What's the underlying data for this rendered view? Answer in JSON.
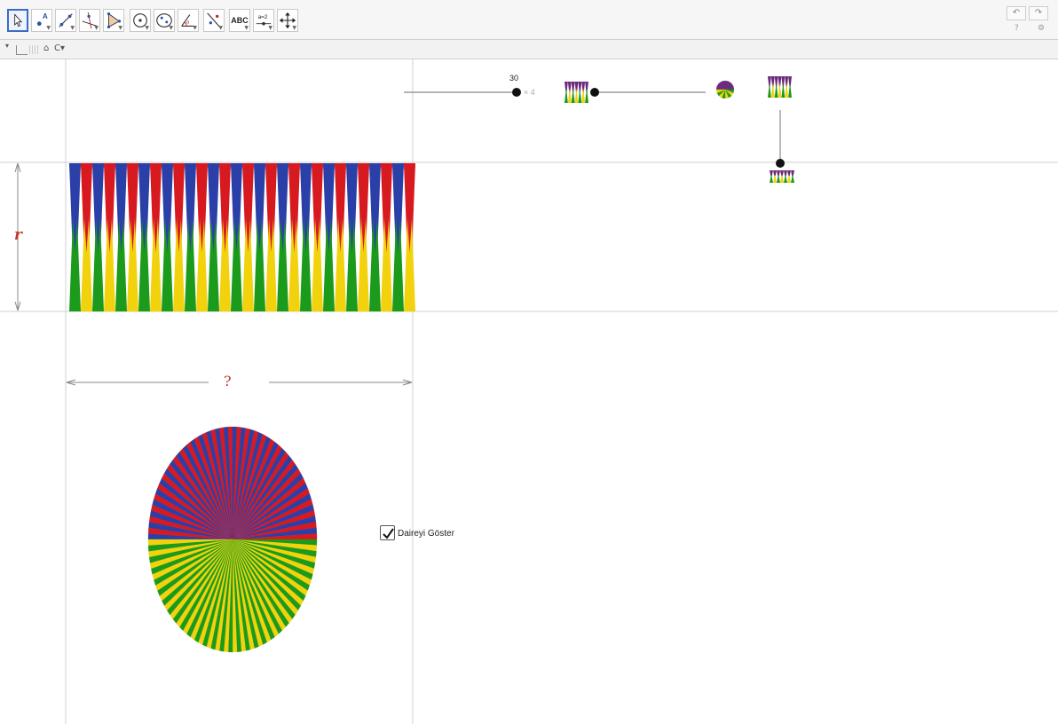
{
  "toolbar": {
    "tools": [
      {
        "name": "move-tool-icon",
        "active": true
      },
      {
        "name": "point-tool-icon"
      },
      {
        "name": "line-tool-icon"
      },
      {
        "name": "perpendicular-tool-icon"
      },
      {
        "name": "polygon-tool-icon"
      },
      {
        "name": "circle-tool-icon"
      },
      {
        "name": "ellipse-tool-icon"
      },
      {
        "name": "angle-tool-icon"
      },
      {
        "name": "reflect-tool-icon"
      },
      {
        "name": "text-tool-icon",
        "label": "ABC"
      },
      {
        "name": "slider-tool-icon",
        "label": "a=2"
      },
      {
        "name": "move-view-tool-icon"
      }
    ],
    "undo_icon": "undo-icon",
    "redo_icon": "redo-icon",
    "undo_glyph": "↶",
    "redo_glyph": "↷",
    "help_glyph": "?",
    "settings_glyph": "⚙"
  },
  "subbar": {
    "caret": "▾",
    "home_glyph": "⌂",
    "zoom_glyph": "C▾"
  },
  "graphics": {
    "slider_n": {
      "value": "30",
      "suffix": "× 4"
    },
    "radius_label": "r",
    "width_label": "?",
    "show_circle": {
      "checked": true,
      "label": "Daireyi Göster"
    },
    "sectors": 120
  },
  "colors": {
    "blue": "#2a3fa8",
    "red": "#d71920",
    "yellow": "#f2d20c",
    "green": "#1b9a1b",
    "purple": "#6b2a7a",
    "label_red": "#c0392b",
    "guide": "#cfcfcf"
  }
}
